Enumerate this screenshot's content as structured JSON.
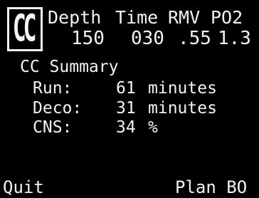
{
  "badge": {
    "text": "CC"
  },
  "header": {
    "labels": [
      "Depth",
      "Time",
      "RMV",
      "PO2"
    ],
    "values": [
      "150",
      "030",
      ".55",
      "1.3"
    ]
  },
  "summary": {
    "title": "CC Summary",
    "rows": [
      {
        "label": "Run:",
        "value": "61",
        "unit": "minutes"
      },
      {
        "label": "Deco:",
        "value": "31",
        "unit": "minutes"
      },
      {
        "label": "CNS:",
        "value": "34",
        "unit": "%"
      }
    ]
  },
  "softkeys": {
    "left": "Quit",
    "right": "Plan BO"
  }
}
